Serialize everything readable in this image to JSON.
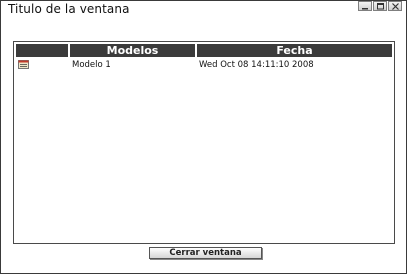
{
  "window": {
    "title": "Titulo de la ventana",
    "controls": [
      "minimize-icon",
      "maximize-icon",
      "close-icon"
    ]
  },
  "grid": {
    "columns": [
      "",
      "Modelos",
      "Fecha"
    ],
    "rows": [
      {
        "icon": "document-edit-icon",
        "modelo": "Modelo 1",
        "fecha": "Wed Oct 08 14:11:10 2008"
      }
    ]
  },
  "footer": {
    "close_label": "Cerrar ventana"
  }
}
